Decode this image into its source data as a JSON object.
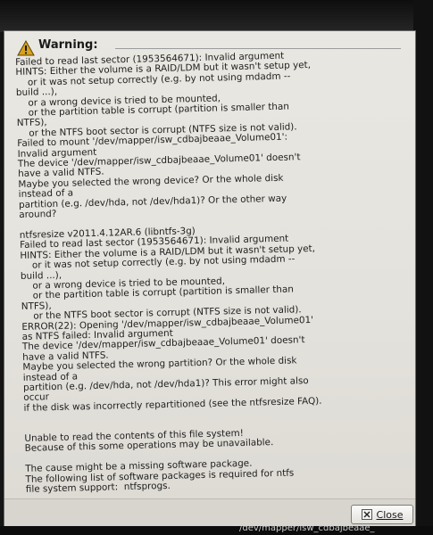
{
  "dialog": {
    "title": "Warning:",
    "message": "Failed to read last sector (1953564671): Invalid argument\nHINTS: Either the volume is a RAID/LDM but it wasn't setup yet,\n    or it was not setup correctly (e.g. by not using mdadm --\nbuild ...),\n    or a wrong device is tried to be mounted,\n    or the partition table is corrupt (partition is smaller than\nNTFS),\n    or the NTFS boot sector is corrupt (NTFS size is not valid).\nFailed to mount '/dev/mapper/isw_cdbajbeaae_Volume01':\nInvalid argument\nThe device '/dev/mapper/isw_cdbajbeaae_Volume01' doesn't\nhave a valid NTFS.\nMaybe you selected the wrong device? Or the whole disk\ninstead of a\npartition (e.g. /dev/hda, not /dev/hda1)? Or the other way\naround?\n\nntfsresize v2011.4.12AR.6 (libntfs-3g)\nFailed to read last sector (1953564671): Invalid argument\nHINTS: Either the volume is a RAID/LDM but it wasn't setup yet,\n    or it was not setup correctly (e.g. by not using mdadm --\nbuild ...),\n    or a wrong device is tried to be mounted,\n    or the partition table is corrupt (partition is smaller than\nNTFS),\n    or the NTFS boot sector is corrupt (NTFS size is not valid).\nERROR(22): Opening '/dev/mapper/isw_cdbajbeaae_Volume01'\nas NTFS failed: Invalid argument\nThe device '/dev/mapper/isw_cdbajbeaae_Volume01' doesn't\nhave a valid NTFS.\nMaybe you selected the wrong partition? Or the whole disk\ninstead of a\npartition (e.g. /dev/hda, not /dev/hda1)? This error might also\noccur\nif the disk was incorrectly repartitioned (see the ntfsresize FAQ).\n\n\nUnable to read the contents of this file system!\nBecause of this some operations may be unavailable.\n\nThe cause might be a missing software package.\nThe following list of software packages is required for ntfs\nfile system support:  ntfsprogs.",
    "close_label": "Close"
  },
  "taskbar": {
    "text": "/dev/mapper/isw_cdbajbeaae_"
  },
  "colors": {
    "dialog_bg": "#e6e4de",
    "warning_icon": "#d8a21c",
    "frame": "#151515"
  },
  "icons": {
    "title": "warning-icon",
    "close": "close-icon"
  }
}
